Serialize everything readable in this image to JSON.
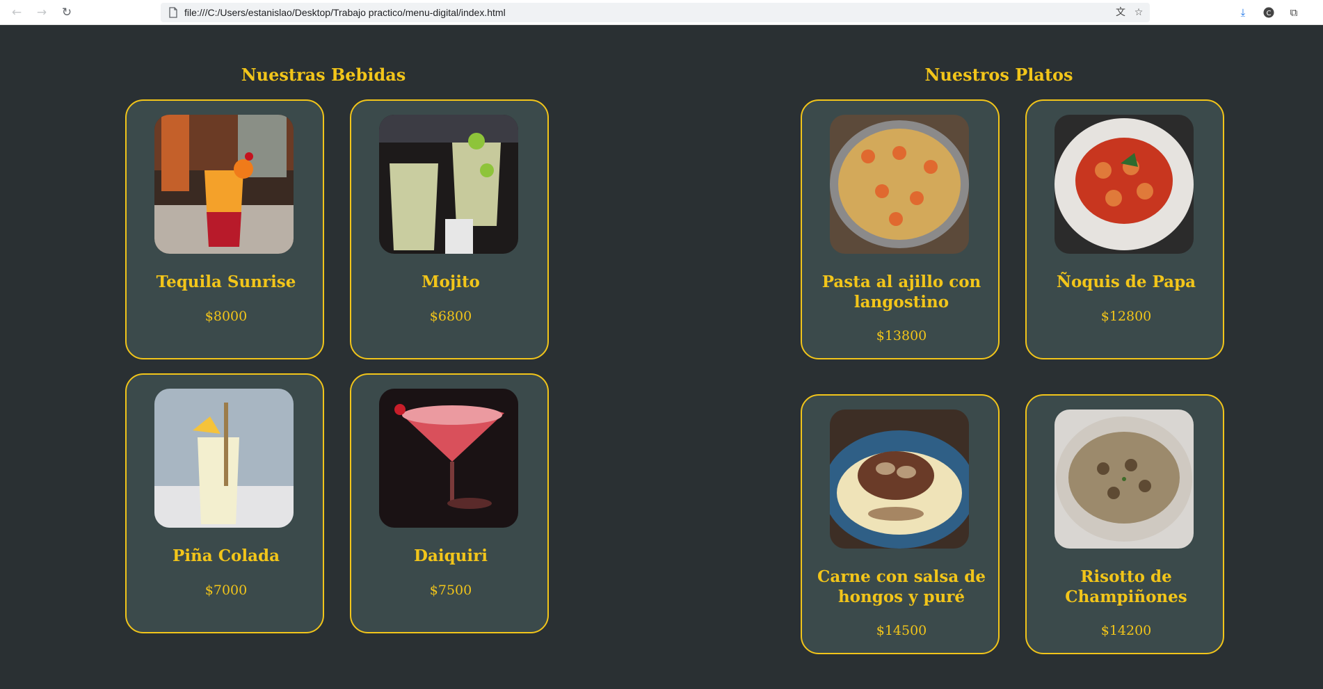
{
  "browser": {
    "url": "file:///C:/Users/estanislao/Desktop/Trabajo practico/menu-digital/index.html",
    "icons": {
      "back": "arrow-left-icon",
      "forward": "arrow-right-icon",
      "reload": "reload-icon",
      "page": "page-icon",
      "translate": "translate-icon",
      "bookmark": "star-icon",
      "downloads": "download-icon",
      "profile": "profile-icon",
      "extensions": "puzzle-icon"
    }
  },
  "theme": {
    "background": "#2a3033",
    "card_background": "#3b4a4b",
    "accent": "#f2c51a"
  },
  "drinks": {
    "title": "Nuestras Bebidas",
    "items": [
      {
        "name": "Tequila Sunrise",
        "price": "$8000",
        "image": "tequila-sunrise-photo"
      },
      {
        "name": "Mojito",
        "price": "$6800",
        "image": "mojito-photo"
      },
      {
        "name": "Piña Colada",
        "price": "$7000",
        "image": "pina-colada-photo"
      },
      {
        "name": "Daiquiri",
        "price": "$7500",
        "image": "daiquiri-photo"
      }
    ]
  },
  "dishes": {
    "title": "Nuestros Platos",
    "items": [
      {
        "name": "Pasta al ajillo con langostino",
        "price": "$13800",
        "image": "pasta-shrimp-photo"
      },
      {
        "name": "Ñoquis de Papa",
        "price": "$12800",
        "image": "gnocchi-photo"
      },
      {
        "name": "Carne con salsa de hongos y puré",
        "price": "$14500",
        "image": "steak-mushroom-photo"
      },
      {
        "name": "Risotto de Champiñones",
        "price": "$14200",
        "image": "risotto-photo"
      }
    ]
  }
}
